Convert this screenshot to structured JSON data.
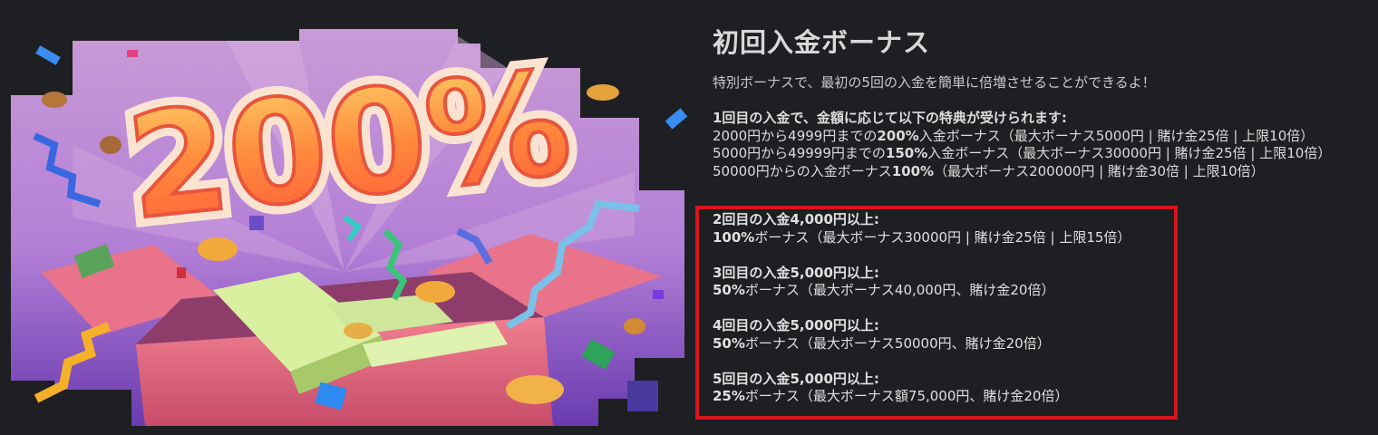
{
  "banner": {
    "big_text": "200%",
    "icons": [
      "gift-box-icon",
      "confetti-icon",
      "coin-icon",
      "cash-stack-icon"
    ]
  },
  "title": "初回入金ボーナス",
  "subtitle": "特別ボーナスで、最初の5回の入金を簡単に倍増させることができるよ！",
  "first": {
    "heading": "1回目の入金で、金額に応じて以下の特典が受けられます:",
    "rows": [
      {
        "pre": "2000円から4999円までの",
        "bold": "200%",
        "post": "入金ボーナス（最大ボーナス5000円 | 賭け金25倍 | 上限10倍）"
      },
      {
        "pre": "5000円から49999円までの",
        "bold": "150%",
        "post": "入金ボーナス（最大ボーナス30000円 | 賭け金25倍 | 上限10倍）"
      },
      {
        "pre": "50000円からの入金ボーナス",
        "bold": "100%",
        "post": "（最大ボーナス200000円 | 賭け金30倍 | 上限10倍）"
      }
    ]
  },
  "later": [
    {
      "heading": "2回目の入金4,000円以上:",
      "bold": "100%",
      "text": "ボーナス（最大ボーナス30000円 | 賭け金25倍 | 上限15倍）"
    },
    {
      "heading": "3回目の入金5,000円以上:",
      "bold": "50%",
      "text": "ボーナス（最大ボーナス40,000円、賭け金20倍）"
    },
    {
      "heading": "4回目の入金5,000円以上:",
      "bold": "50%",
      "text": "ボーナス（最大ボーナス50000円、賭け金20倍）"
    },
    {
      "heading": "5回目の入金5,000円以上:",
      "bold": "25%",
      "text": "ボーナス（最大ボーナス額75,000円、賭け金20倍）"
    }
  ],
  "highlight_color": "#d8141f"
}
